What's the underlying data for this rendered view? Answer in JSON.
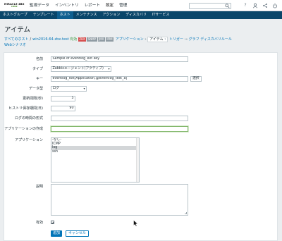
{
  "topbar": {
    "logo_text": "MIRACLE ZBX",
    "logo_sub": "LINUX",
    "menu": [
      "監視データ",
      "インベントリ",
      "レポート",
      "設定",
      "管理"
    ],
    "icons": [
      "question-icon",
      "user-icon",
      "share-icon",
      "power-icon"
    ]
  },
  "subbar": {
    "items": [
      "ホストグループ",
      "テンプレート",
      "ホスト",
      "メンテナンス",
      "アクション",
      "ディスカバリ",
      "ITサービス"
    ],
    "active": "ホスト"
  },
  "page": {
    "title": "アイテム"
  },
  "breadcrumb": {
    "all_hosts": "すべてのホスト",
    "sep": "/",
    "host": "win2016-64-zbx-test",
    "status": "有効",
    "tags": [
      "ZBX",
      "SNMP",
      "JMX",
      "IPMI"
    ],
    "applications": "アプリケーション",
    "applications_count": "3",
    "items": "アイテム",
    "items_count": "7",
    "triggers": "トリガー",
    "triggers_count": "10",
    "graphs": "グラフ",
    "discovery": "ディスカバリルール",
    "web": "Webシナリオ"
  },
  "form": {
    "name_label": "名前",
    "name_value": "Sample of eventlog_ext key",
    "type_label": "タイプ",
    "type_value": "Zabbixエージェント(アクティブ)",
    "key_label": "キー",
    "key_value": "eventlog_ext[Application,@eventlog_test_a]",
    "key_button": "選択",
    "datatype_label": "データ型",
    "datatype_value": "ログ",
    "interval_label": "更新間隔(秒)",
    "interval_value": "5",
    "history_label": "ヒストリ保存期間(日)",
    "history_value": "90",
    "logtime_label": "ログの時間の形式",
    "logtime_value": "",
    "newapp_label": "アプリケーションの作成",
    "newapp_value": "",
    "apps_label": "アプリケーション",
    "apps_options": [
      "-なし-",
      "ICMP",
      "log",
      "ssh"
    ],
    "apps_selected": "log",
    "desc_label": "説明",
    "desc_value": "",
    "enabled_label": "有効",
    "enabled_checked": true,
    "add_button": "追加",
    "cancel_button": "キャンセル"
  }
}
